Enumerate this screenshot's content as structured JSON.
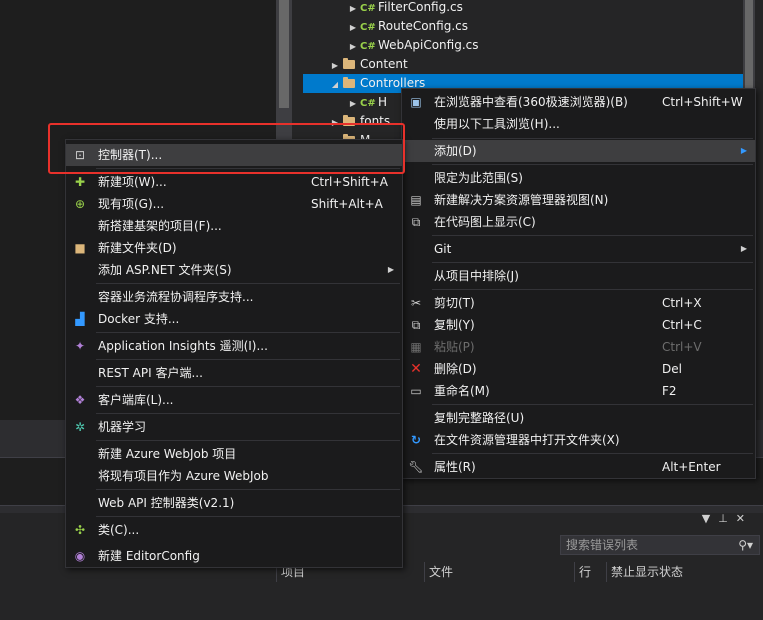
{
  "solution_tree": [
    {
      "label": "FilterConfig.cs",
      "type": "cs"
    },
    {
      "label": "RouteConfig.cs",
      "type": "cs"
    },
    {
      "label": "WebApiConfig.cs",
      "type": "cs"
    },
    {
      "label": "Content",
      "type": "folder"
    },
    {
      "label": "Controllers",
      "type": "folder",
      "selected": true
    },
    {
      "label": "H",
      "type": "cs"
    },
    {
      "label": "fonts",
      "type": "folder"
    },
    {
      "label": "M",
      "type": "folder"
    }
  ],
  "context_menu": {
    "items": [
      {
        "label": "在浏览器中查看(360极速浏览器)(B)",
        "shortcut": "Ctrl+Shift+W",
        "icon": "browser-icon"
      },
      {
        "label": "使用以下工具浏览(H)...",
        "shortcut": ""
      },
      {
        "label": "添加(D)",
        "shortcut": "",
        "submenu": true
      },
      {
        "label": "限定为此范围(S)",
        "shortcut": ""
      },
      {
        "label": "新建解决方案资源管理器视图(N)",
        "shortcut": "",
        "icon": "new-view-icon"
      },
      {
        "label": "在代码图上显示(C)",
        "shortcut": "",
        "icon": "code-map-icon"
      },
      {
        "label": "Git",
        "shortcut": "",
        "submenu": true
      },
      {
        "label": "从项目中排除(J)",
        "shortcut": ""
      },
      {
        "label": "剪切(T)",
        "shortcut": "Ctrl+X",
        "icon": "scissors-icon"
      },
      {
        "label": "复制(Y)",
        "shortcut": "Ctrl+C",
        "icon": "copy-icon"
      },
      {
        "label": "粘贴(P)",
        "shortcut": "Ctrl+V",
        "icon": "paste-icon",
        "disabled": true
      },
      {
        "label": "删除(D)",
        "shortcut": "Del",
        "icon": "delete-icon"
      },
      {
        "label": "重命名(M)",
        "shortcut": "F2",
        "icon": "rename-icon"
      },
      {
        "label": "复制完整路径(U)",
        "shortcut": ""
      },
      {
        "label": "在文件资源管理器中打开文件夹(X)",
        "shortcut": "",
        "icon": "refresh-icon"
      },
      {
        "label": "属性(R)",
        "shortcut": "Alt+Enter",
        "icon": "wrench-icon"
      }
    ]
  },
  "add_submenu": {
    "items": [
      {
        "label": "控制器(T)...",
        "shortcut": "",
        "icon": "controller-icon"
      },
      {
        "label": "新建项(W)...",
        "shortcut": "Ctrl+Shift+A",
        "icon": "new-item-icon"
      },
      {
        "label": "现有项(G)...",
        "shortcut": "Shift+Alt+A",
        "icon": "existing-item-icon"
      },
      {
        "label": "新搭建基架的项目(F)...",
        "shortcut": ""
      },
      {
        "label": "新建文件夹(D)",
        "shortcut": "",
        "icon": "new-folder-icon"
      },
      {
        "label": "添加 ASP.NET 文件夹(S)",
        "shortcut": "",
        "submenu": true
      },
      {
        "label": "容器业务流程协调程序支持...",
        "shortcut": ""
      },
      {
        "label": "Docker 支持...",
        "shortcut": "",
        "icon": "docker-icon"
      },
      {
        "label": "Application Insights 遥测(I)...",
        "shortcut": "",
        "icon": "insights-icon"
      },
      {
        "label": "REST API 客户端...",
        "shortcut": ""
      },
      {
        "label": "客户端库(L)...",
        "shortcut": "",
        "icon": "library-icon"
      },
      {
        "label": "机器学习",
        "shortcut": "",
        "icon": "ml-icon"
      },
      {
        "label": "新建 Azure WebJob 项目",
        "shortcut": ""
      },
      {
        "label": "将现有项目作为 Azure WebJob",
        "shortcut": ""
      },
      {
        "label": "Web API 控制器类(v2.1)",
        "shortcut": ""
      },
      {
        "label": "类(C)...",
        "shortcut": "",
        "icon": "class-icon"
      },
      {
        "label": "新建 EditorConfig",
        "shortcut": "",
        "icon": "editorconfig-icon"
      }
    ]
  },
  "error_list": {
    "search_placeholder": "搜索错误列表",
    "columns": [
      "项目",
      "文件",
      "行",
      "禁止显示状态"
    ]
  },
  "colors": {
    "selection": "#007acc",
    "highlight_box": "#e8312b",
    "menu_bg": "#1b1b1c"
  }
}
